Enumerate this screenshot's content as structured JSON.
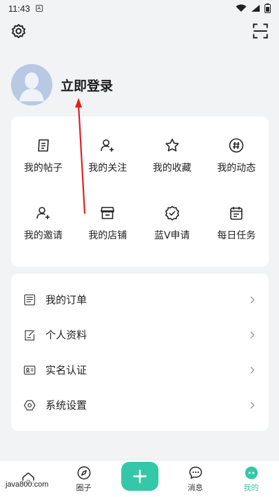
{
  "status_bar": {
    "time": "11:43"
  },
  "profile": {
    "login_label": "立即登录"
  },
  "grid": [
    {
      "label": "我的帖子",
      "icon": "post-icon"
    },
    {
      "label": "我的关注",
      "icon": "follow-icon"
    },
    {
      "label": "我的收藏",
      "icon": "star-icon"
    },
    {
      "label": "我的动态",
      "icon": "hashtag-icon"
    },
    {
      "label": "我的邀请",
      "icon": "invite-icon"
    },
    {
      "label": "我的店铺",
      "icon": "store-icon"
    },
    {
      "label": "蓝V申请",
      "icon": "verified-badge-icon"
    },
    {
      "label": "每日任务",
      "icon": "calendar-icon"
    }
  ],
  "list": [
    {
      "label": "我的订单",
      "icon": "order-icon"
    },
    {
      "label": "个人资料",
      "icon": "profile-edit-icon"
    },
    {
      "label": "实名认证",
      "icon": "id-card-icon"
    },
    {
      "label": "系统设置",
      "icon": "hexagon-settings-icon"
    }
  ],
  "tabs": [
    {
      "label": "",
      "icon": "home-icon"
    },
    {
      "label": "圈子",
      "icon": "compass-icon"
    },
    {
      "label": "",
      "icon": "plus-icon"
    },
    {
      "label": "消息",
      "icon": "message-icon"
    },
    {
      "label": "我的",
      "icon": "mine-face-icon"
    }
  ],
  "watermark": "java800.com",
  "colors": {
    "accent": "#35c8a8",
    "annotation_arrow": "#e02020"
  }
}
